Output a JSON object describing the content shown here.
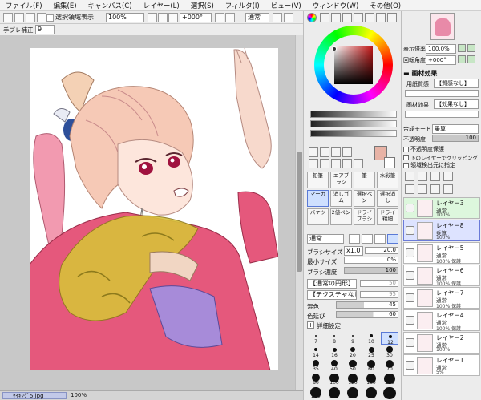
{
  "menu": [
    "ファイル(F)",
    "編集(E)",
    "キャンバス(C)",
    "レイヤー(L)",
    "選択(S)",
    "フィルタ(I)",
    "ビュー(V)",
    "ウィンドウ(W)",
    "その他(O)"
  ],
  "toolbar": {
    "selection_visible_label": "選択領域表示",
    "zoom_value": "100%",
    "rotate_value": "+000°",
    "blend_value": "通常"
  },
  "stabilizer": {
    "label": "手ブレ補正",
    "value": "9"
  },
  "navigator": {
    "zoom_label": "表示倍率",
    "zoom_value": "100.0%",
    "rotate_label": "回転角度",
    "rotate_value": "+000°"
  },
  "paper_effect": {
    "header": "画材効果",
    "texture_label": "用紙質感",
    "texture_value": "【質感なし】",
    "effect_label": "画材効果",
    "effect_value": "【効果なし】"
  },
  "blend": {
    "label": "合成モード",
    "value": "乗算",
    "opacity_label": "不透明度",
    "opacity_value": "100"
  },
  "options": [
    "不透明度保護",
    "下のレイヤーでクリッピング",
    "領域検出元に指定"
  ],
  "tool_groups": [
    [
      "鉛筆",
      "エアブラシ",
      "筆",
      "水彩筆"
    ],
    [
      "マーカー",
      "消しゴム",
      "選択ペン",
      "選択消し"
    ],
    [
      "バケツ",
      "2値ペン",
      "ドライブラシ",
      "ドライ精細"
    ]
  ],
  "brush": {
    "mode_value": "通常",
    "size_label": "ブラシサイズ",
    "size_mult": "x1.0",
    "size_value": "20.0",
    "min_label": "最小サイズ",
    "min_value": "0%",
    "density_label": "ブラシ濃度",
    "density_value": "100",
    "shape_value": "【通常の円形】",
    "shape_num": "50",
    "texture_value": "【テクスチャなし】",
    "texture_num": "95",
    "mix_label": "混色",
    "mix_value": "45",
    "extend_label": "色延び",
    "extend_value": "60",
    "detail_label": "詳細設定"
  },
  "brush_sizes": [
    "7",
    "8",
    "9",
    "10",
    "12",
    "14",
    "16",
    "20",
    "25",
    "30",
    "35",
    "40",
    "50",
    "60",
    "70",
    "80",
    "100",
    "120",
    "160",
    "200",
    "250",
    "300",
    "350",
    "400",
    "500"
  ],
  "layers": [
    {
      "name": "レイヤー3",
      "mode": "通常",
      "opacity": "100%"
    },
    {
      "name": "レイヤー8",
      "mode": "乗算",
      "opacity": "100%"
    },
    {
      "name": "レイヤー5",
      "mode": "通常",
      "opacity": "100% 保護"
    },
    {
      "name": "レイヤー6",
      "mode": "通常",
      "opacity": "100% 保護"
    },
    {
      "name": "レイヤー7",
      "mode": "通常",
      "opacity": "100% 保護"
    },
    {
      "name": "レイヤー4",
      "mode": "通常",
      "opacity": "100% 保護"
    },
    {
      "name": "レイヤー2",
      "mode": "通常",
      "opacity": "100%"
    },
    {
      "name": "レイヤー1",
      "mode": "通常",
      "opacity": "5%"
    }
  ],
  "status": {
    "filename": "ｾｲｷﾝｸﾞ5.jpg",
    "zoom": "100%"
  },
  "colors": {
    "current": "#e8b3a6",
    "accent": "#4a6fd8",
    "hue_box_base": "#9b1d1d"
  }
}
